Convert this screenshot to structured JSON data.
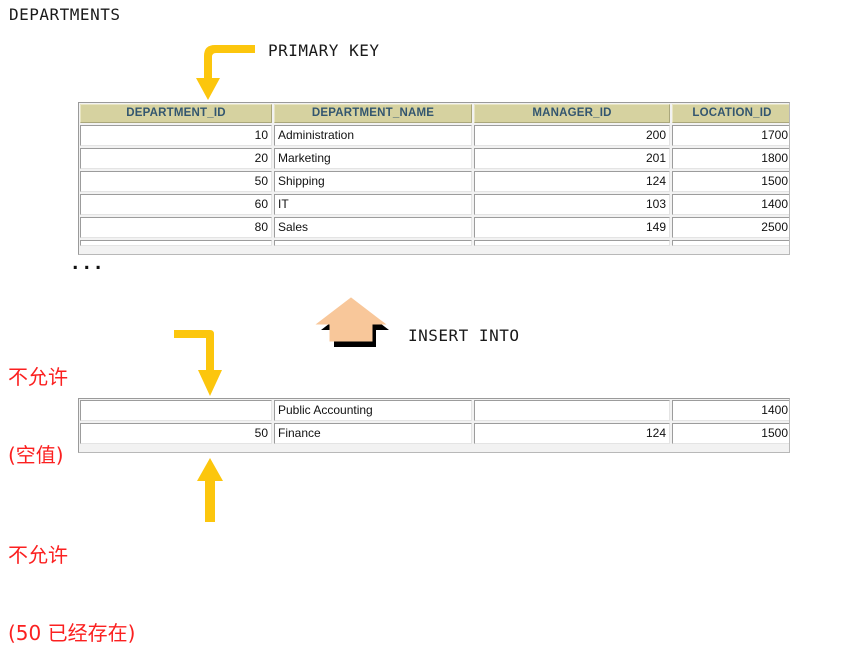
{
  "page": {
    "title": "DEPARTMENTS"
  },
  "callouts": {
    "primary_key": "PRIMARY KEY",
    "insert_into": "INSERT INTO"
  },
  "annotations": {
    "null_not_allowed": {
      "line1": "不允许",
      "line2": "(空值)"
    },
    "duplicate_not_allowed": {
      "line1": "不允许",
      "line2": "(50 已经存在)"
    }
  },
  "colors": {
    "header_bg": "#d6d2a0",
    "header_text": "#33566f",
    "arrow_yellow": "#fcc60d",
    "arrow_peach": "#f8c79a",
    "arrow_shadow": "#000000",
    "annotation_red": "#fb2020"
  },
  "departments_table": {
    "columns": [
      "DEPARTMENT_ID",
      "DEPARTMENT_NAME",
      "MANAGER_ID",
      "LOCATION_ID"
    ],
    "rows": [
      {
        "department_id": "10",
        "department_name": "Administration",
        "manager_id": "200",
        "location_id": "1700"
      },
      {
        "department_id": "20",
        "department_name": "Marketing",
        "manager_id": "201",
        "location_id": "1800"
      },
      {
        "department_id": "50",
        "department_name": "Shipping",
        "manager_id": "124",
        "location_id": "1500"
      },
      {
        "department_id": "60",
        "department_name": "IT",
        "manager_id": "103",
        "location_id": "1400"
      },
      {
        "department_id": "80",
        "department_name": "Sales",
        "manager_id": "149",
        "location_id": "2500"
      }
    ],
    "more_indicator": "..."
  },
  "insert_rows_table": {
    "rows": [
      {
        "department_id": "",
        "department_name": "Public Accounting",
        "manager_id": "",
        "location_id": "1400"
      },
      {
        "department_id": "50",
        "department_name": "Finance",
        "manager_id": "124",
        "location_id": "1500"
      }
    ]
  },
  "arrows": [
    {
      "name": "primary-key-arrow",
      "style": "elbow-right-down",
      "color": "#fcc60d"
    },
    {
      "name": "null-constraint-arrow",
      "style": "elbow-right-down",
      "color": "#fcc60d"
    },
    {
      "name": "duplicate-key-arrow",
      "style": "straight-up",
      "color": "#fcc60d"
    },
    {
      "name": "insert-into-arrow",
      "style": "block-up-shadow",
      "color": "#f8c79a"
    }
  ]
}
